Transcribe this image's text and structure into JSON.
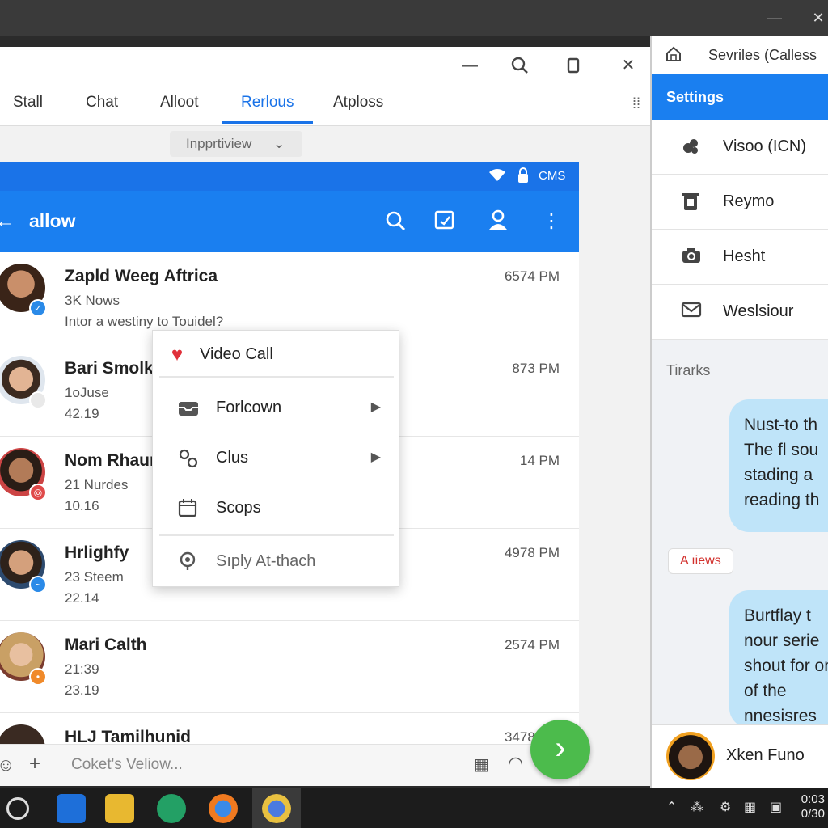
{
  "window": {
    "tabs": [
      {
        "label": "Stall"
      },
      {
        "label": "Chat"
      },
      {
        "label": "Alloot"
      },
      {
        "label": "Rerlous"
      },
      {
        "label": "Atploss"
      }
    ],
    "active_tab": "Rerlous",
    "view_selector": "Inpprtiview"
  },
  "app": {
    "status_text": "CMS",
    "title": "allow",
    "accent": "#1a7ff0",
    "conversations": [
      {
        "name": "Zapld Weeg Aftrica",
        "sub1": "3K Nows",
        "sub2": "Intor a westiny to Touidel?",
        "time": "6574 PM"
      },
      {
        "name": "Bari Smolk",
        "sub1": "1oJuse",
        "sub2": "42.19",
        "time": "873 PM"
      },
      {
        "name": "Nom Rhaun",
        "sub1": "21 Nurdes",
        "sub2": "10.16",
        "time": "14 PM"
      },
      {
        "name": "Hrlighfy",
        "sub1": "23 Steem",
        "sub2": "22.14",
        "time": "4978 PM"
      },
      {
        "name": "Mari Calth",
        "sub1": "21:39",
        "sub2": "23.19",
        "time": "2574 PM"
      },
      {
        "name": "HLJ Tamilhunid",
        "sub1": "",
        "sub2": "",
        "time": "3478 PM"
      }
    ],
    "composer_placeholder": "Coket's Veliow..."
  },
  "context_menu": {
    "items": [
      {
        "label": "Video Call",
        "icon": "heart-icon"
      },
      {
        "label": "Forlcown",
        "icon": "inbox-icon",
        "submenu": true
      },
      {
        "label": "Clus",
        "icon": "link-icon",
        "submenu": true
      },
      {
        "label": "Scops",
        "icon": "calendar-icon"
      },
      {
        "label": "Sıply At-thach",
        "icon": "location-icon"
      }
    ]
  },
  "right_panel": {
    "header_title": "Sevriles (Calless",
    "settings_label": "Settings",
    "items": [
      {
        "label": "Visoo (ICN)",
        "icon": "palette-icon"
      },
      {
        "label": "Reymo",
        "icon": "trash-icon"
      },
      {
        "label": "Hesht",
        "icon": "camera-icon"
      },
      {
        "label": "Weslsiour",
        "icon": "mail-icon"
      }
    ],
    "section_label": "Tirarks",
    "bubble1": "Nust-to th The fl sou stading a reading th",
    "chip": "A ıiews",
    "bubble2": "Burtflay t nour serie shout for ond of the nnesisres",
    "contact_name": "Xken Funo"
  },
  "taskbar": {
    "tray_time": "0:03",
    "tray_date": "0/30"
  }
}
